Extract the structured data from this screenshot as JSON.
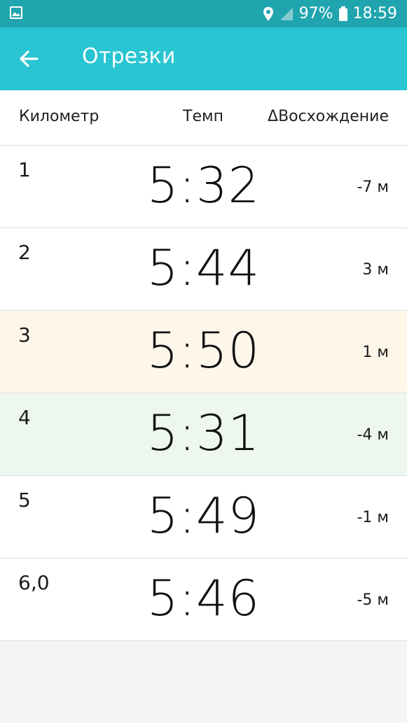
{
  "status_bar": {
    "battery": "97%",
    "time": "18:59",
    "icons": [
      "image-icon",
      "location-icon",
      "signal-icon",
      "battery-icon"
    ]
  },
  "app_bar": {
    "title": "Отрезки",
    "back_icon": "arrow-left-icon",
    "color": "#2ac5d2"
  },
  "table": {
    "headers": {
      "km": "Километр",
      "pace": "Темп",
      "elevation": "ΔВосхождение"
    },
    "rows": [
      {
        "km": "1",
        "pace": "5:32",
        "elevation": "-7 м",
        "highlight": "none"
      },
      {
        "km": "2",
        "pace": "5:44",
        "elevation": "3 м",
        "highlight": "none"
      },
      {
        "km": "3",
        "pace": "5:50",
        "elevation": "1 м",
        "highlight": "slowest"
      },
      {
        "km": "4",
        "pace": "5:31",
        "elevation": "-4 м",
        "highlight": "fastest"
      },
      {
        "km": "5",
        "pace": "5:49",
        "elevation": "-1 м",
        "highlight": "none"
      },
      {
        "km": "6,0",
        "pace": "5:46",
        "elevation": "-5 м",
        "highlight": "none"
      }
    ]
  },
  "colors": {
    "status_bar": "#20a5ae",
    "slowest_row": "#fff6ea",
    "fastest_row": "#edf7ee"
  }
}
